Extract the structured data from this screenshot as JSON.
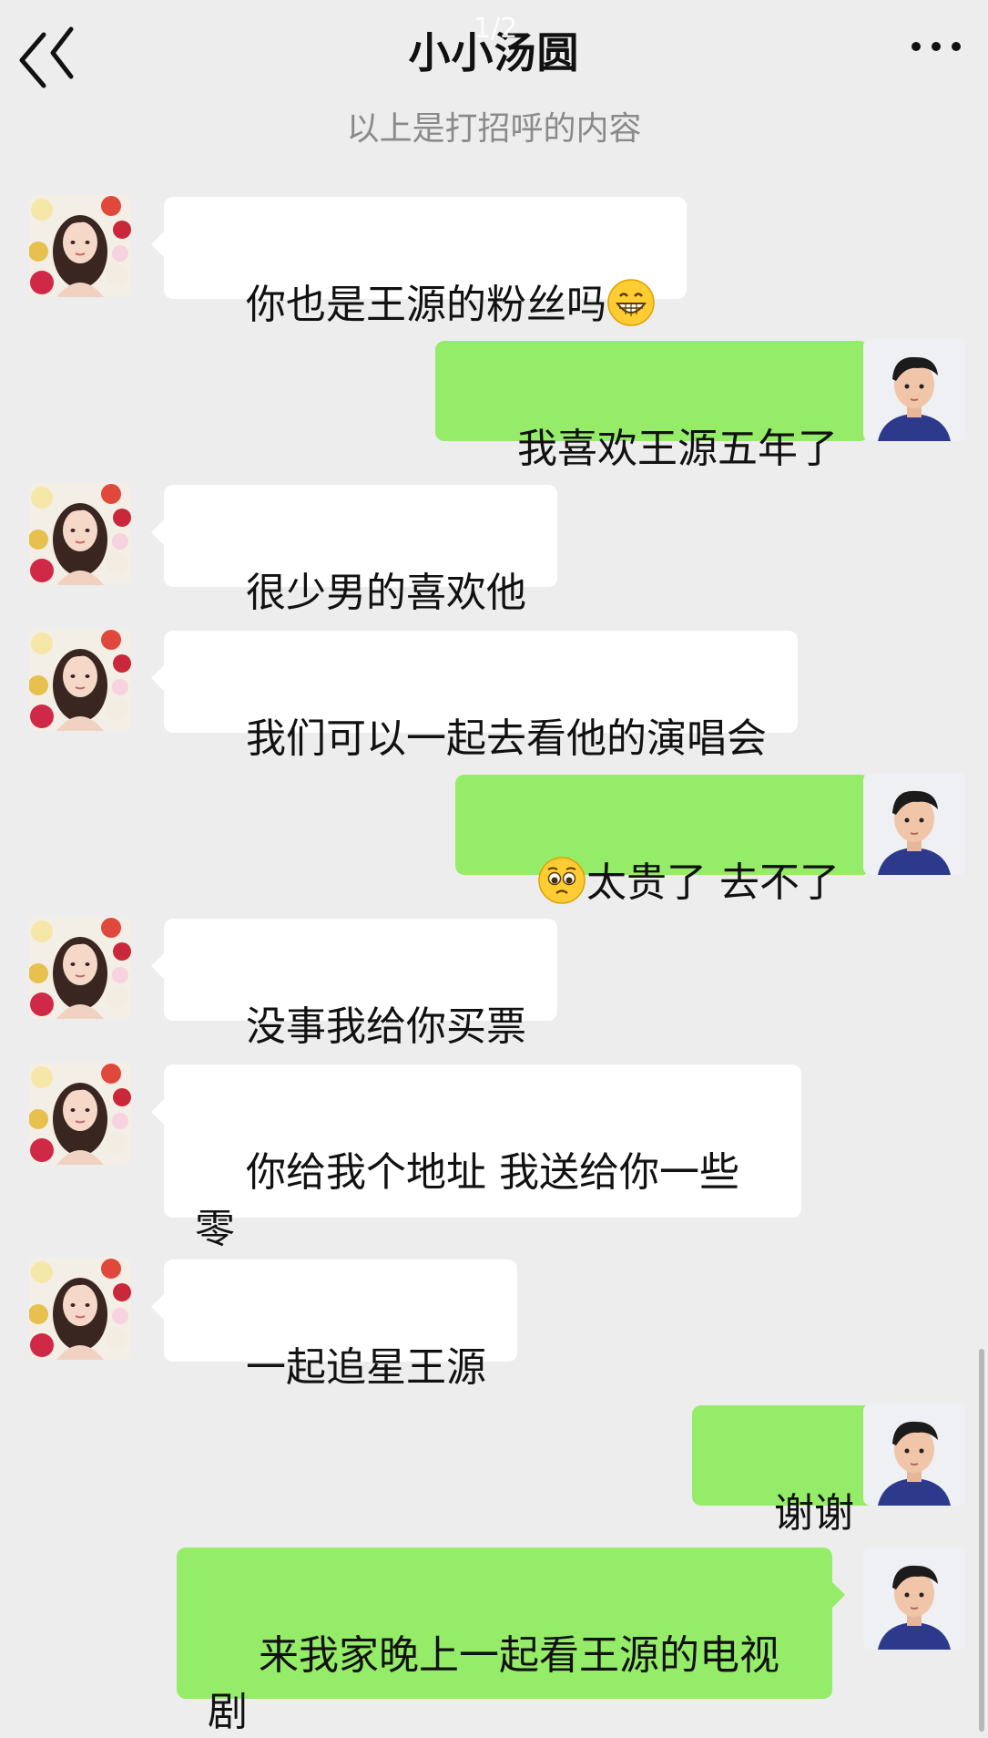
{
  "header": {
    "title": "小小汤圆",
    "page_indicator": "1/2",
    "back_icon": "double-chevron-left-icon",
    "more_icon": "more-dots-icon"
  },
  "system_note": "以上是打招呼的内容",
  "colors": {
    "background": "#ededed",
    "incoming_bubble": "#ffffff",
    "outgoing_bubble": "#95ec69"
  },
  "messages": [
    {
      "side": "in",
      "text": "你也是王源的粉丝吗",
      "emoji_after": "grinning-face-icon"
    },
    {
      "side": "out",
      "text": "我喜欢王源五年了"
    },
    {
      "side": "in",
      "text": "很少男的喜欢他"
    },
    {
      "side": "in",
      "text": "我们可以一起去看他的演唱会"
    },
    {
      "side": "out",
      "text": "太贵了 去不了",
      "emoji_before": "pleading-face-icon"
    },
    {
      "side": "in",
      "text": "没事我给你买票"
    },
    {
      "side": "in",
      "text": "你给我个地址 我送给你一些零\n食还有水果"
    },
    {
      "side": "in",
      "text": "一起追星王源"
    },
    {
      "side": "out",
      "text": "谢谢"
    },
    {
      "side": "out",
      "text": "来我家晚上一起看王源的电视剧\n电影"
    }
  ]
}
